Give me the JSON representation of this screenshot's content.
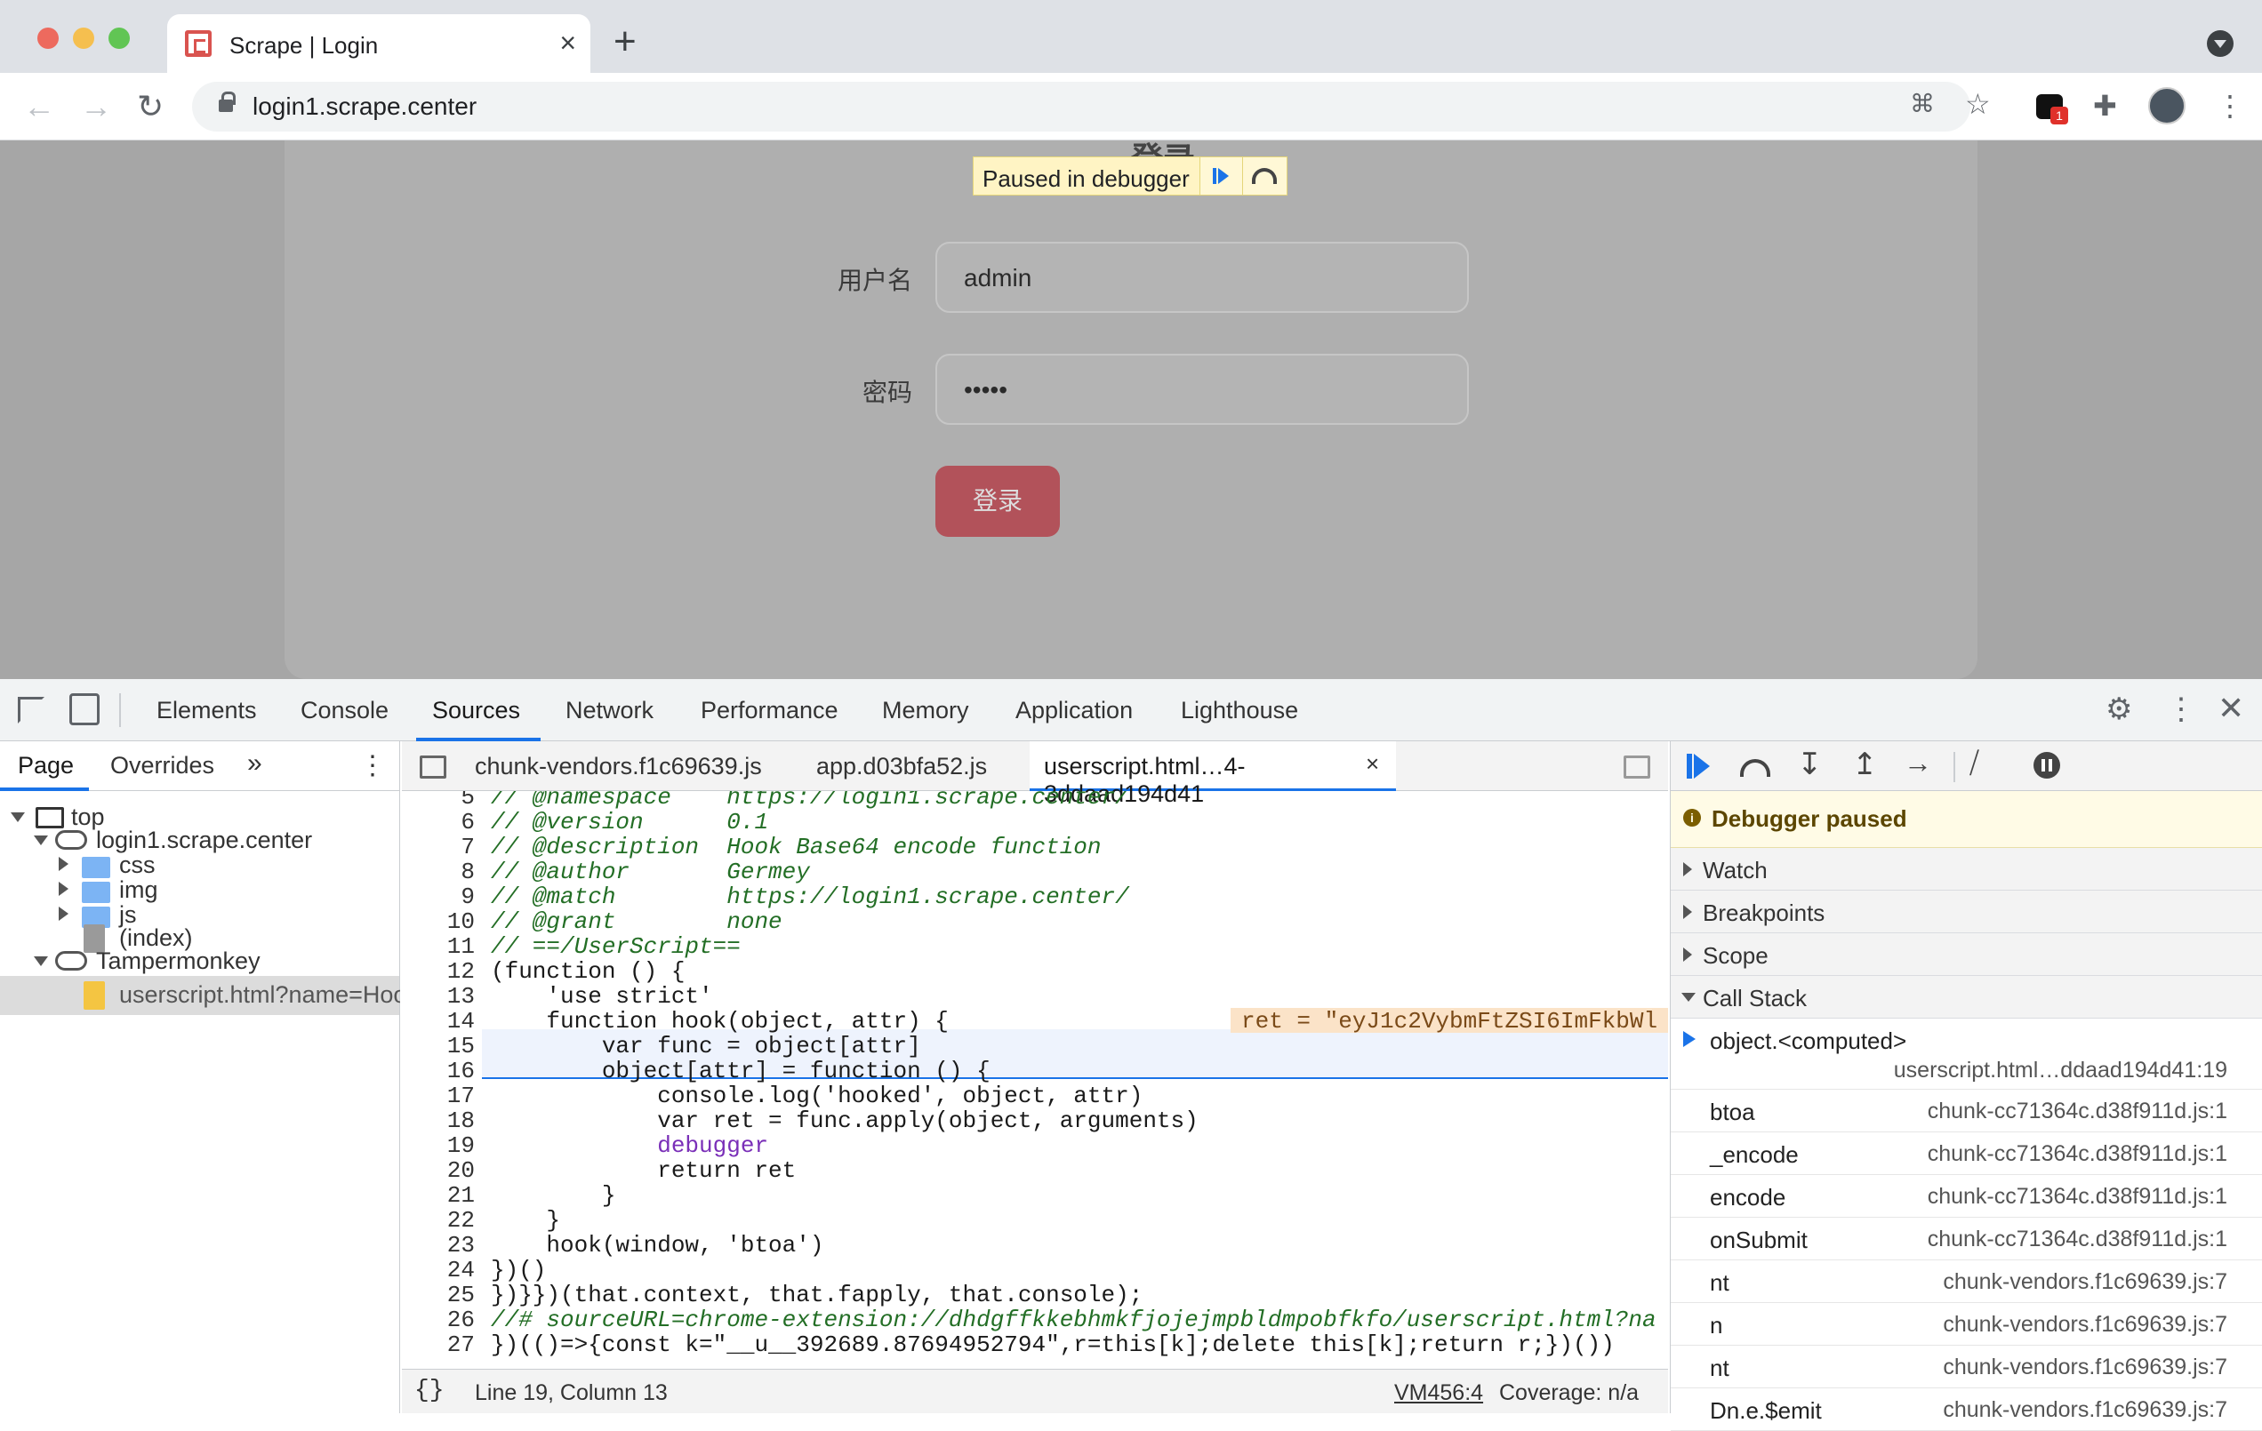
{
  "browser": {
    "tab_title": "Scrape | Login",
    "url": "login1.scrape.center"
  },
  "overlay": {
    "paused": "Paused in debugger"
  },
  "form": {
    "username_label": "用户名",
    "username_value": "admin",
    "password_label": "密码",
    "password_value": "•••••",
    "title_partial": "登录",
    "submit": "登录"
  },
  "devtools": {
    "tabs": [
      "Elements",
      "Console",
      "Sources",
      "Network",
      "Performance",
      "Memory",
      "Application",
      "Lighthouse"
    ],
    "nav_tabs": [
      "Page",
      "Overrides"
    ],
    "tree": [
      "top",
      "login1.scrape.center",
      "css",
      "img",
      "js",
      "(index)",
      "Tampermonkey",
      "userscript.html?name=Hoo"
    ],
    "editor_tabs": [
      "chunk-vendors.f1c69639.js",
      "app.d03bfa52.js",
      "userscript.html…4-3ddaad194d41"
    ],
    "status": {
      "position": "Line 19, Column 13",
      "vm": "VM456:4",
      "coverage": "Coverage: n/a"
    },
    "debugger": {
      "paused": "Debugger paused",
      "sections": [
        "Watch",
        "Breakpoints",
        "Scope",
        "Call Stack"
      ],
      "top_frame": {
        "fn": "object.<computed>",
        "loc": "userscript.html…ddaad194d41:19"
      },
      "frames": [
        {
          "fn": "btoa",
          "loc": "chunk-cc71364c.d38f911d.js:1"
        },
        {
          "fn": "_encode",
          "loc": "chunk-cc71364c.d38f911d.js:1"
        },
        {
          "fn": "encode",
          "loc": "chunk-cc71364c.d38f911d.js:1"
        },
        {
          "fn": "onSubmit",
          "loc": "chunk-cc71364c.d38f911d.js:1"
        },
        {
          "fn": "nt",
          "loc": "chunk-vendors.f1c69639.js:7"
        },
        {
          "fn": "n",
          "loc": "chunk-vendors.f1c69639.js:7"
        },
        {
          "fn": "nt",
          "loc": "chunk-vendors.f1c69639.js:7"
        },
        {
          "fn": "Dn.e.$emit",
          "loc": "chunk-vendors.f1c69639.js:7"
        }
      ]
    },
    "inline_value": "ret = \"eyJ1c2VybmFtZSI6ImFkbWl",
    "code": [
      {
        "n": "5",
        "t": "// @namespace    https://login1.scrape.center/"
      },
      {
        "n": "6",
        "t": "// @version      0.1"
      },
      {
        "n": "7",
        "t": "// @description  Hook Base64 encode function"
      },
      {
        "n": "8",
        "t": "// @author       Germey"
      },
      {
        "n": "9",
        "t": "// @match        https://login1.scrape.center/"
      },
      {
        "n": "10",
        "t": "// @grant        none"
      },
      {
        "n": "11",
        "t": "// ==/UserScript=="
      },
      {
        "n": "12",
        "t": "(function () {"
      },
      {
        "n": "13",
        "t": "    'use strict'"
      },
      {
        "n": "14",
        "t": "    function hook(object, attr) {"
      },
      {
        "n": "15",
        "t": "        var func = object[attr]"
      },
      {
        "n": "16",
        "t": "        object[attr] = function () {"
      },
      {
        "n": "17",
        "t": "            console.log('hooked', object, attr)"
      },
      {
        "n": "18",
        "t": "            var ret = func.apply(object, arguments)"
      },
      {
        "n": "19",
        "t": "            debugger"
      },
      {
        "n": "20",
        "t": "            return ret"
      },
      {
        "n": "21",
        "t": "        }"
      },
      {
        "n": "22",
        "t": "    }"
      },
      {
        "n": "23",
        "t": "    hook(window, 'btoa')"
      },
      {
        "n": "24",
        "t": "})()"
      },
      {
        "n": "25",
        "t": "})}})(that.context, that.fapply, that.console);"
      },
      {
        "n": "26",
        "t": "//# sourceURL=chrome-extension://dhdgffkkebhmkfjojejmpbldmpobfkfo/userscript.html?na"
      },
      {
        "n": "27",
        "t": "})(()=>{const k=\"__u__392689.87694952794\",r=this[k];delete this[k];return r;})())"
      }
    ]
  }
}
